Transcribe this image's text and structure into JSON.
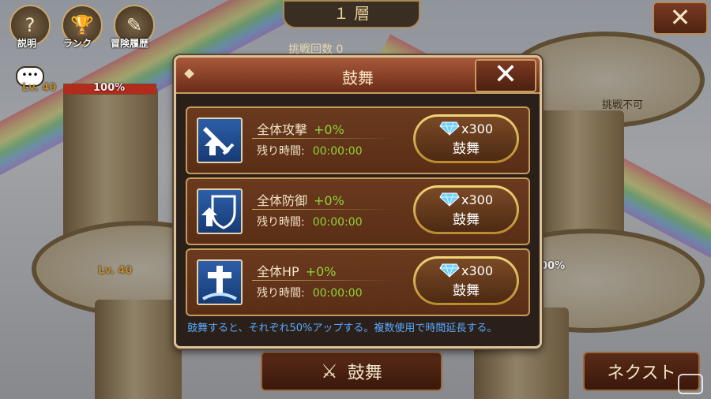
{
  "top_icons": [
    {
      "label": "説明",
      "glyph": "?"
    },
    {
      "label": "ランク",
      "glyph": "🏆"
    },
    {
      "label": "冒険履歴",
      "glyph": "✎"
    }
  ],
  "floor_label": "１ 層",
  "challenge_count_label": "挑戦回数 0",
  "close_glyph": "✕",
  "chat_glyph": "•••",
  "player_lv_label": "Lv. 40",
  "player_hp_label": "100%",
  "hp_fill_fraction": 1.0,
  "enemy_lv_label": "Lv. 40",
  "enemy_hp_label": "00%",
  "no_challenge_label": "挑戦不可",
  "bottom": {
    "encourage_label": "鼓舞",
    "next_label": "ネクスト"
  },
  "dialog": {
    "title": "鼓舞",
    "close_glyph": "✕",
    "rows": [
      {
        "name": "全体攻撃",
        "bonus": "+0%",
        "time_label": "残り時間:",
        "time": "00:00:00",
        "cost": "x300",
        "button": "鼓舞",
        "icon": "sword-icon"
      },
      {
        "name": "全体防御",
        "bonus": "+0%",
        "time_label": "残り時間:",
        "time": "00:00:00",
        "cost": "x300",
        "button": "鼓舞",
        "icon": "shield-icon"
      },
      {
        "name": "全体HP",
        "bonus": "+0%",
        "time_label": "残り時間:",
        "time": "00:00:00",
        "cost": "x300",
        "button": "鼓舞",
        "icon": "cross-icon"
      }
    ],
    "note": "鼓舞すると、それぞれ50%アップする。複数使用で時間延長する。"
  },
  "colors": {
    "accent_green": "#8fd43a",
    "note_blue": "#58a8ff",
    "gem_blue": "#6fd0ff"
  }
}
